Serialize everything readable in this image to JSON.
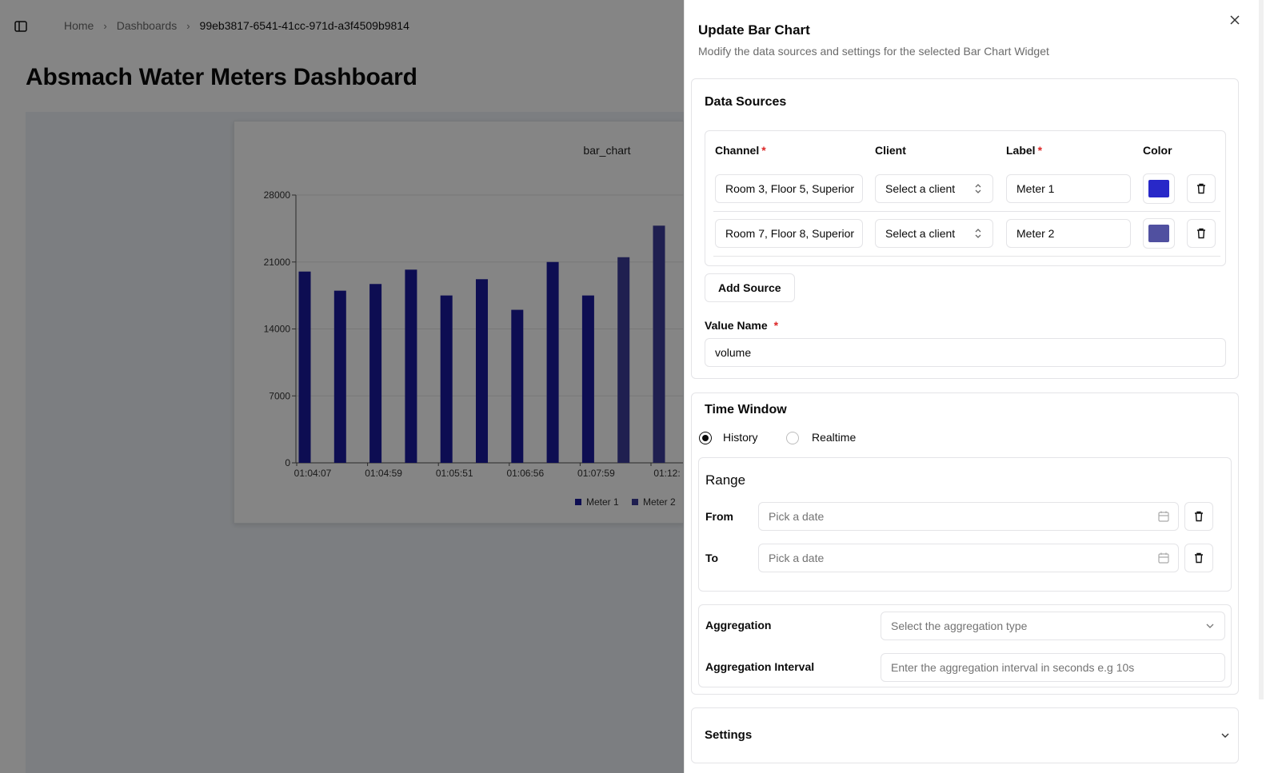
{
  "breadcrumb": {
    "home": "Home",
    "dashboards": "Dashboards",
    "current": "99eb3817-6541-41cc-971d-a3f4509b9814"
  },
  "page": {
    "title": "Absmach Water Meters Dashboard"
  },
  "chart_data": {
    "type": "bar",
    "title": "bar_chart",
    "categories": [
      "01:04:07",
      "",
      "01:04:59",
      "",
      "01:05:51",
      "",
      "01:06:56",
      "",
      "01:07:59",
      "",
      "01:12:"
    ],
    "series": [
      {
        "name": "Meter 1",
        "color": "#1a1a9e",
        "values": [
          20000,
          18000,
          18700,
          20200,
          17500,
          19200,
          16000,
          21000,
          17500,
          null,
          null
        ]
      },
      {
        "name": "Meter 2",
        "color": "#3c3c9a",
        "values": [
          null,
          null,
          null,
          null,
          null,
          null,
          null,
          null,
          null,
          21500,
          24800
        ]
      }
    ],
    "yticks": [
      0,
      7000,
      14000,
      21000,
      28000
    ],
    "ylim": [
      0,
      28000
    ],
    "legend_position": "bottom",
    "grid": true
  },
  "sheet": {
    "title": "Update Bar Chart",
    "description": "Modify the data sources and settings for the selected Bar Chart Widget",
    "data_sources": {
      "title": "Data Sources",
      "headers": {
        "channel": "Channel",
        "client": "Client",
        "label": "Label",
        "color": "Color",
        "required_mark": "*"
      },
      "rows": [
        {
          "channel": "Room 3, Floor 5, Superior",
          "client": "Select a client",
          "label": "Meter 1",
          "color": "#2828c8"
        },
        {
          "channel": "Room 7, Floor 8, Superior",
          "client": "Select a client",
          "label": "Meter 2",
          "color": "#5050a0"
        }
      ],
      "add_source": "Add Source",
      "value_name_label": "Value Name",
      "value_name": "volume"
    },
    "time_window": {
      "title": "Time Window",
      "history": "History",
      "realtime": "Realtime",
      "selected": "History",
      "range_title": "Range",
      "from_label": "From",
      "to_label": "To",
      "date_placeholder": "Pick a date",
      "aggregation_label": "Aggregation",
      "aggregation_placeholder": "Select the aggregation type",
      "interval_label": "Aggregation Interval",
      "interval_placeholder": "Enter the aggregation interval in seconds e.g 10s"
    },
    "settings": {
      "title": "Settings"
    }
  }
}
